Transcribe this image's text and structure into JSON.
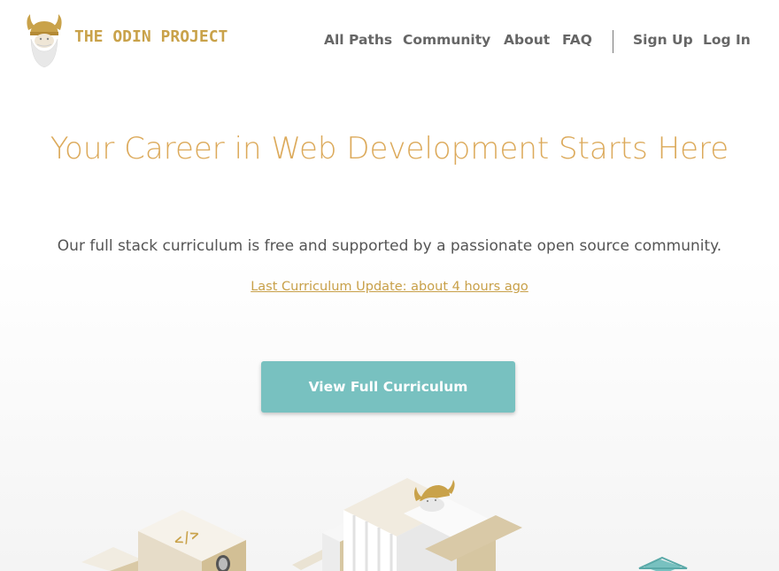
{
  "brand": {
    "name": "THE ODIN PROJECT",
    "logo_icon": "viking-helmet-logo-icon",
    "color": "#c9a24a"
  },
  "nav": {
    "items": [
      {
        "label": "All Paths"
      },
      {
        "label": "Community"
      },
      {
        "label": "About"
      },
      {
        "label": "FAQ"
      },
      {
        "label": "Sign Up"
      },
      {
        "label": "Log In"
      }
    ]
  },
  "hero": {
    "title": "Your Career in Web Development Starts Here",
    "subtitle": "Our full stack curriculum is free and supported by a passionate open source community.",
    "update_link": "Last Curriculum Update: about 4 hours ago",
    "cta_label": "View Full Curriculum",
    "title_color": "#dcaa5b",
    "cta_color": "#78c1c0"
  },
  "illustration": {
    "icon": "isometric-city-illustration",
    "code_tag": "</>"
  }
}
